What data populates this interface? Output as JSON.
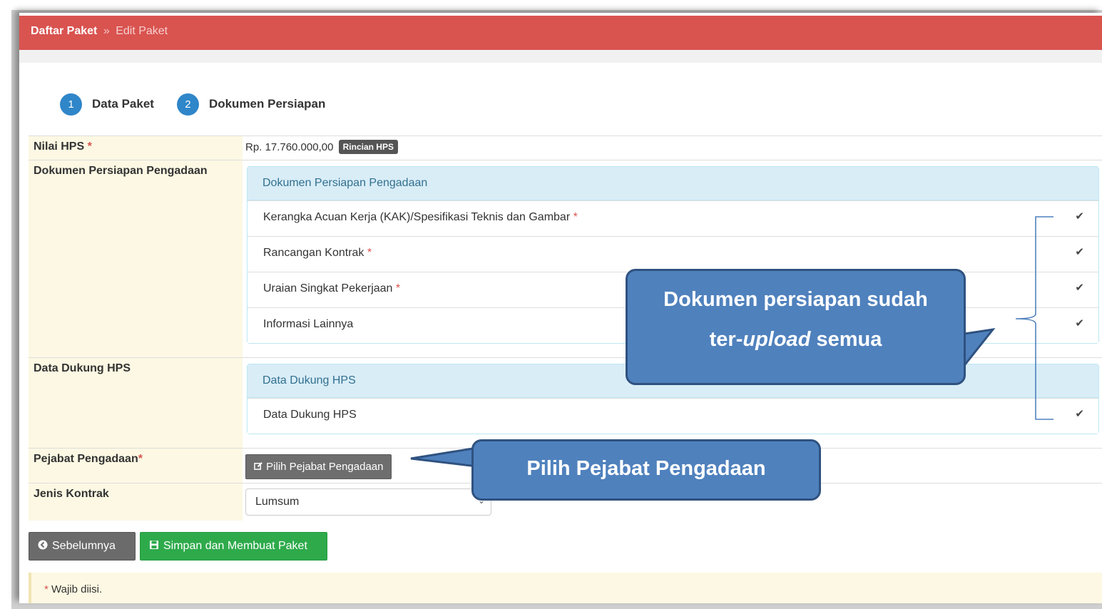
{
  "breadcrumb": {
    "main": "Daftar Paket",
    "separator": "»",
    "current": "Edit Paket"
  },
  "steps": [
    {
      "number": "1",
      "label": "Data Paket"
    },
    {
      "number": "2",
      "label": "Dokumen Persiapan"
    }
  ],
  "form": {
    "nilai_hps": {
      "label": "Nilai HPS",
      "required": "*",
      "value": "Rp. 17.760.000,00",
      "badge": "Rincian HPS"
    },
    "dokumen_persiapan": {
      "label": "Dokumen Persiapan Pengadaan",
      "panel_title": "Dokumen Persiapan Pengadaan",
      "items": [
        {
          "label": "Kerangka Acuan Kerja (KAK)/Spesifikasi Teknis dan Gambar",
          "required": "*",
          "check": "✔"
        },
        {
          "label": "Rancangan Kontrak",
          "required": "*",
          "check": "✔"
        },
        {
          "label": "Uraian Singkat Pekerjaan",
          "required": "*",
          "check": "✔"
        },
        {
          "label": "Informasi Lainnya",
          "required": "",
          "check": "✔"
        }
      ]
    },
    "data_dukung": {
      "label": "Data Dukung HPS",
      "panel_title": "Data Dukung HPS",
      "items": [
        {
          "label": "Data Dukung HPS",
          "check": "✔"
        }
      ]
    },
    "pejabat": {
      "label": "Pejabat Pengadaan",
      "required": "*",
      "button": "Pilih Pejabat Pengadaan"
    },
    "jenis_kontrak": {
      "label": "Jenis Kontrak",
      "selected": "Lumsum"
    }
  },
  "buttons": {
    "prev": "Sebelumnya",
    "save": "Simpan dan Membuat Paket"
  },
  "note": {
    "star": "*",
    "text": "Wajib diisi."
  },
  "callouts": {
    "uploaded_line1": "Dokumen persiapan sudah",
    "uploaded_line2_prefix": "ter-",
    "uploaded_line2_italic": "upload",
    "uploaded_line2_suffix": " semua",
    "pilih": "Pilih Pejabat Pengadaan"
  },
  "colors": {
    "header_red": "#d9534f",
    "step_blue": "#2f86c9",
    "callout_blue": "#4f81bd",
    "save_green": "#2eaa4b"
  },
  "icons": {
    "edit": "edit-icon",
    "back": "circle-arrow-left-icon",
    "save": "floppy-disk-icon",
    "check": "check-icon"
  }
}
